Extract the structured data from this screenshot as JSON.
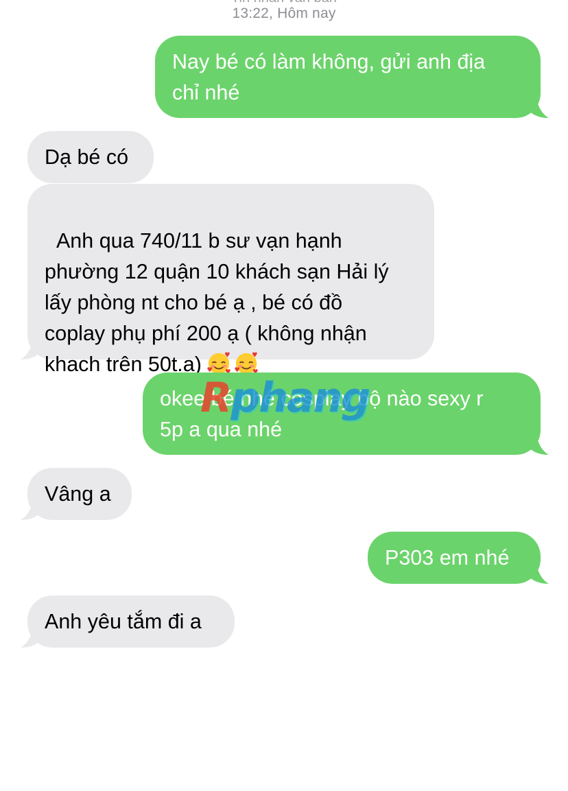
{
  "header": {
    "subtitle": "Tin nhắn văn bản",
    "timestamp": "13:22, Hôm nay"
  },
  "messages": [
    {
      "direction": "outgoing",
      "text": "Nay bé có làm không, gửi anh địa\nchỉ nhé"
    },
    {
      "direction": "incoming",
      "text": "Dạ bé có"
    },
    {
      "direction": "incoming",
      "text": "Anh qua 740/11 b sư vạn hạnh\nphường 12 quận 10 khách sạn Hải lý\nlấy phòng nt cho bé ạ , bé có đồ\ncoplay phụ phí 200 ạ ( không nhận\nkhach trên 50t.ạ)",
      "emoji": [
        "smiling-face-with-hearts",
        "smiling-face-with-hearts"
      ]
    },
    {
      "direction": "outgoing",
      "text": "okee bé nhé cosplay bộ nào sexy r\n5p a qua nhé"
    },
    {
      "direction": "incoming",
      "text": "Vâng a"
    },
    {
      "direction": "outgoing",
      "text": "P303 em nhé"
    },
    {
      "direction": "incoming",
      "text": "Anh yêu tắm đi a"
    }
  ],
  "watermark": {
    "first_letter": "R",
    "rest": "phang"
  },
  "colors": {
    "outgoing_bubble": "#6bd36b",
    "incoming_bubble": "#e9e9eb",
    "outgoing_text": "#ffffff",
    "incoming_text": "#000000",
    "watermark_red": "#e8432f",
    "watermark_blue": "#1a8fd8",
    "watermark_cyan": "#2bc9c9"
  }
}
